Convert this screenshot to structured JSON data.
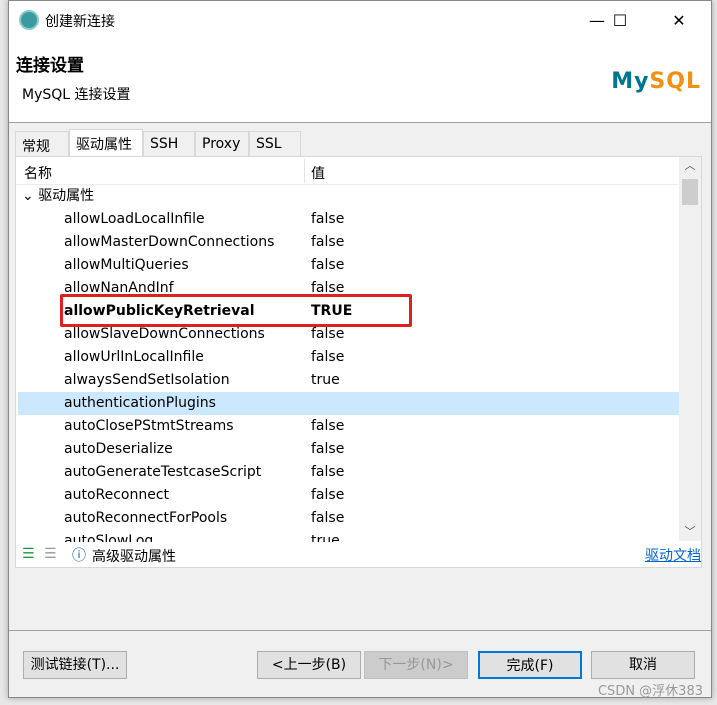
{
  "window": {
    "title": "创建新连接",
    "minimize": "—",
    "maximize": "☐",
    "close": "✕"
  },
  "header": {
    "title": "连接设置",
    "subtitle": "MySQL 连接设置",
    "logo": "MySQL"
  },
  "tabs": [
    {
      "label": "常规"
    },
    {
      "label": "驱动属性",
      "active": true
    },
    {
      "label": "SSH"
    },
    {
      "label": "Proxy"
    },
    {
      "label": "SSL"
    }
  ],
  "table": {
    "col_name": "名称",
    "col_value": "值",
    "group": "驱动属性",
    "rows": [
      {
        "name": "allowLoadLocalInfile",
        "value": "false"
      },
      {
        "name": "allowMasterDownConnections",
        "value": "false"
      },
      {
        "name": "allowMultiQueries",
        "value": "false"
      },
      {
        "name": "allowNanAndInf",
        "value": "false"
      },
      {
        "name": "allowPublicKeyRetrieval",
        "value": "TRUE"
      },
      {
        "name": "allowSlaveDownConnections",
        "value": "false"
      },
      {
        "name": "allowUrlInLocalInfile",
        "value": "false"
      },
      {
        "name": "alwaysSendSetIsolation",
        "value": "true"
      },
      {
        "name": "authenticationPlugins",
        "value": ""
      },
      {
        "name": "autoClosePStmtStreams",
        "value": "false"
      },
      {
        "name": "autoDeserialize",
        "value": "false"
      },
      {
        "name": "autoGenerateTestcaseScript",
        "value": "false"
      },
      {
        "name": "autoReconnect",
        "value": "false"
      },
      {
        "name": "autoReconnectForPools",
        "value": "false"
      },
      {
        "name": "autoSlowLog",
        "value": "true"
      }
    ]
  },
  "footer": {
    "advanced": "高级驱动属性",
    "docs_link": "驱动文档"
  },
  "buttons": {
    "test": "测试链接(T)...",
    "back": "<上一步(B)",
    "next": "下一步(N)>",
    "finish": "完成(F)",
    "cancel": "取消"
  },
  "watermark": "CSDN @浮休383",
  "colors": {
    "highlight": "#e02020",
    "selection": "#cce8ff",
    "accent": "#0078d7"
  }
}
